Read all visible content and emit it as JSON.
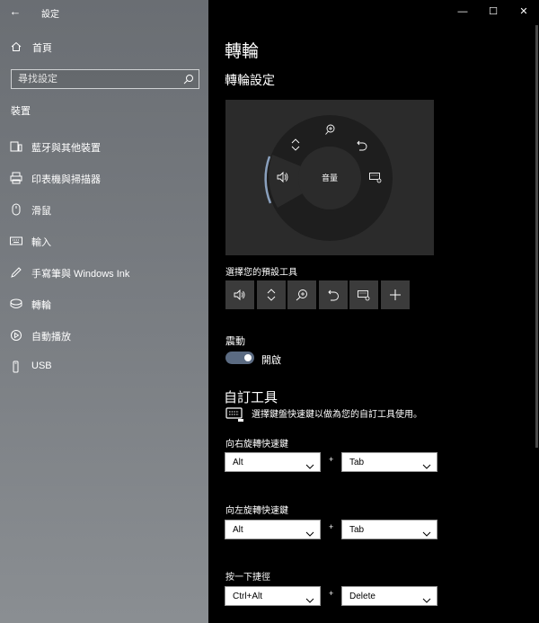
{
  "window": {
    "title": "設定",
    "back_icon": "←",
    "controls": {
      "minimize": "—",
      "maximize": "☐",
      "close": "✕"
    }
  },
  "sidebar": {
    "home_label": "首頁",
    "search_placeholder": "尋找設定",
    "section_title": "裝置",
    "items": [
      {
        "label": "藍牙與其他裝置",
        "icon": "bluetooth-devices-icon"
      },
      {
        "label": "印表機與掃描器",
        "icon": "printer-icon"
      },
      {
        "label": "滑鼠",
        "icon": "mouse-icon"
      },
      {
        "label": "輸入",
        "icon": "keyboard-icon"
      },
      {
        "label": "手寫筆與 Windows Ink",
        "icon": "pen-icon"
      },
      {
        "label": "轉輪",
        "icon": "dial-icon"
      },
      {
        "label": "自動播放",
        "icon": "autoplay-icon"
      },
      {
        "label": "USB",
        "icon": "usb-icon"
      }
    ]
  },
  "main": {
    "title": "轉輪",
    "subtitle": "轉輪設定",
    "wheel_center_label": "音量",
    "default_tools_label": "選擇您的預設工具",
    "default_tools": [
      "volume-icon",
      "scroll-icon",
      "zoom-icon",
      "undo-icon",
      "brightness-keyboard-icon",
      "add-icon"
    ],
    "vibration_label": "震動",
    "vibration_state": "開啟",
    "vibration_on": true,
    "custom_title": "自訂工具",
    "custom_desc": "選擇鍵盤快速鍵以做為您的自訂工具使用。",
    "shortcuts": [
      {
        "label": "向右旋轉快速鍵",
        "modifier": "Alt",
        "key": "Tab"
      },
      {
        "label": "向左旋轉快速鍵",
        "modifier": "Alt",
        "key": "Tab"
      },
      {
        "label": "按一下捷徑",
        "modifier": "Ctrl+Alt",
        "key": "Delete"
      }
    ],
    "plus_sign": "+"
  },
  "colors": {
    "sidebar_top": "#6a6e73",
    "content_bg": "#000000",
    "toggle_on": "#5b6b82",
    "preview_bg": "#2b2b2b",
    "tool_bg": "#3b3b3b"
  }
}
